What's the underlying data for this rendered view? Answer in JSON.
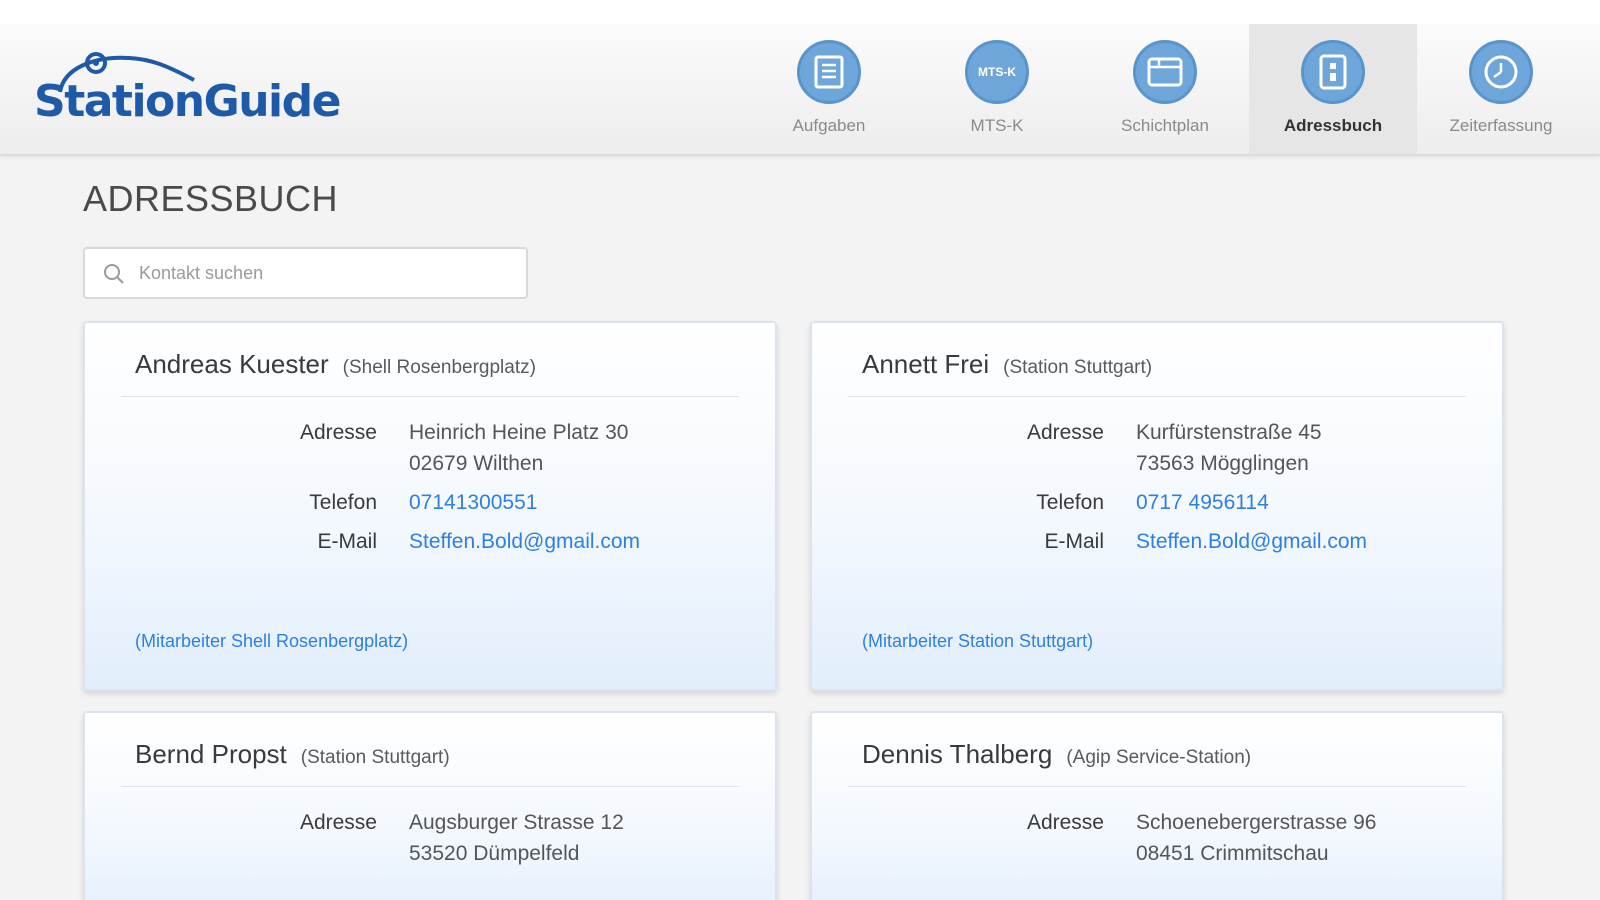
{
  "app": {
    "logo_text": "StationGuide"
  },
  "nav": [
    {
      "label": "Aufgaben",
      "icon": "clipboard-list-icon",
      "active": false
    },
    {
      "label": "MTS-K",
      "icon": "mts-k-icon",
      "badge": "MTS-K",
      "active": false
    },
    {
      "label": "Schichtplan",
      "icon": "schedule-icon",
      "active": false
    },
    {
      "label": "Adressbuch",
      "icon": "address-book-icon",
      "active": true
    },
    {
      "label": "Zeiterfassung",
      "icon": "clock-icon",
      "active": false
    }
  ],
  "page": {
    "title": "ADRESSBUCH"
  },
  "search": {
    "placeholder": "Kontakt suchen",
    "value": ""
  },
  "labels": {
    "address": "Adresse",
    "phone": "Telefon",
    "email": "E-Mail"
  },
  "contacts": [
    {
      "name": "Andreas Kuester",
      "station": "(Shell Rosenbergplatz)",
      "address_line1": "Heinrich Heine Platz 30",
      "address_line2": "02679 Wilthen",
      "phone": "07141300551",
      "email": "Steffen.Bold@gmail.com",
      "staff_link": "(Mitarbeiter Shell Rosenbergplatz)"
    },
    {
      "name": "Annett Frei",
      "station": "(Station Stuttgart)",
      "address_line1": "Kurfürstenstraße 45",
      "address_line2": "73563 Mögglingen",
      "phone": "0717 4956114",
      "email": "Steffen.Bold@gmail.com",
      "staff_link": "(Mitarbeiter Station Stuttgart)"
    },
    {
      "name": "Bernd Propst",
      "station": "(Station Stuttgart)",
      "address_line1": "Augsburger Strasse 12",
      "address_line2": "53520 Dümpelfeld"
    },
    {
      "name": "Dennis Thalberg",
      "station": "(Agip Service-Station)",
      "address_line1": "Schoenebergerstrasse 96",
      "address_line2": "08451 Crimmitschau"
    }
  ],
  "colors": {
    "brand": "#1f5aa8",
    "icon_fill": "#6ea6da",
    "link": "#2e7fe2"
  }
}
